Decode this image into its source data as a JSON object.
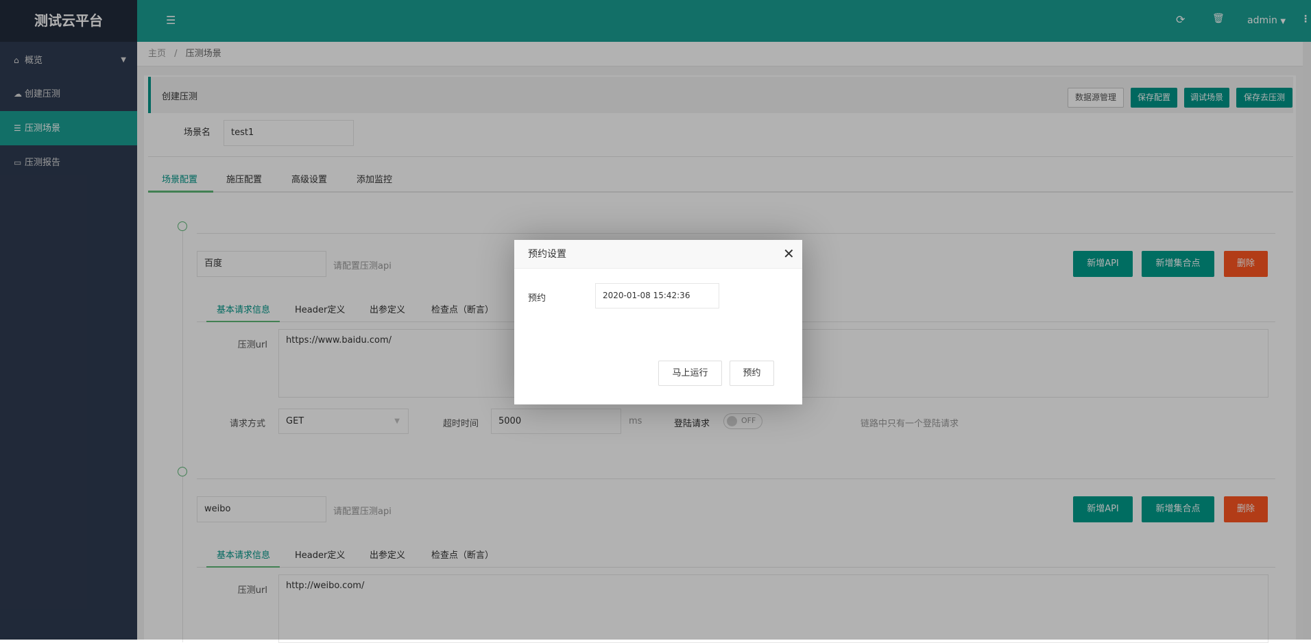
{
  "app": {
    "title": "测试云平台"
  },
  "sidebar": {
    "items": [
      {
        "label": "概览",
        "icon": "home-icon"
      },
      {
        "label": "创建压测",
        "icon": "cloud-icon"
      },
      {
        "label": "压测场景",
        "icon": "server-icon",
        "active": true
      },
      {
        "label": "压测报告",
        "icon": "monitor-icon"
      }
    ]
  },
  "header": {
    "user": "admin"
  },
  "breadcrumb": {
    "home": "主页",
    "sep": "/",
    "current": "压测场景"
  },
  "panel": {
    "title": "创建压测",
    "buttons": {
      "datasource": "数据源管理",
      "save": "保存配置",
      "debug": "调试场景",
      "save_run": "保存去压测"
    }
  },
  "scene": {
    "name_label": "场景名",
    "name_value": "test1"
  },
  "tabs": [
    "场景配置",
    "施压配置",
    "高级设置",
    "添加监控"
  ],
  "steps": [
    {
      "name": "百度",
      "hint": "请配置压测api",
      "url": "https://www.baidu.com/"
    },
    {
      "name": "weibo",
      "hint": "请配置压测api",
      "url": "http://weibo.com/"
    }
  ],
  "step_buttons": {
    "add_api": "新增API",
    "add_point": "新增集合点",
    "delete": "删除"
  },
  "subtabs": [
    "基本请求信息",
    "Header定义",
    "出参定义",
    "检查点（断言）"
  ],
  "fields": {
    "url_label": "压测url",
    "method_label": "请求方式",
    "method_value": "GET",
    "timeout_label": "超时时间",
    "timeout_value": "5000",
    "timeout_unit": "ms",
    "login_label": "登陆请求",
    "toggle": "OFF",
    "login_hint": "链路中只有一个登陆请求"
  },
  "dialog": {
    "title": "预约设置",
    "label": "预约",
    "value": "2020-01-08 15:42:36",
    "run_now": "马上运行",
    "schedule": "预约"
  },
  "colors": {
    "accent": "#009688",
    "danger": "#ff5722",
    "sidebar": "#2f3b52"
  }
}
